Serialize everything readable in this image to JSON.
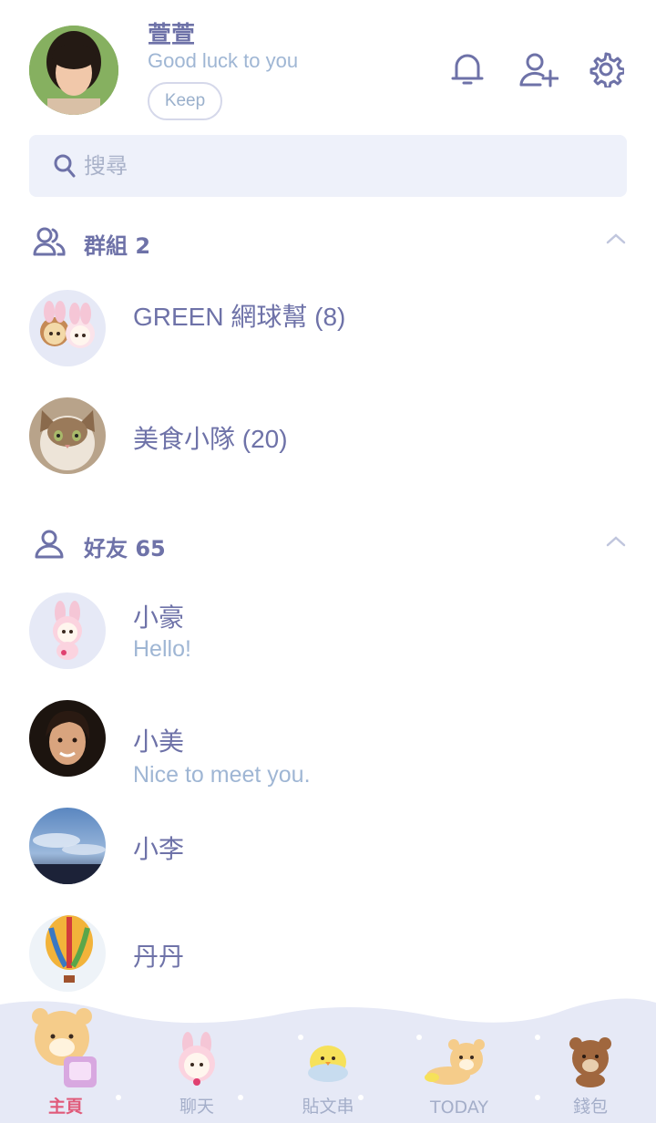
{
  "profile": {
    "name": "萱萱",
    "status": "Good luck to you",
    "keep_label": "Keep"
  },
  "header_icons": [
    "bell-icon",
    "add-friend-icon",
    "settings-gear-icon"
  ],
  "search": {
    "placeholder": "搜尋"
  },
  "groups": {
    "header": "群組 2",
    "items": [
      {
        "title": "GREEN 網球幫 (8)",
        "avatar": "rilakkuma-bunny-pair"
      },
      {
        "title": "美食小隊 (20)",
        "avatar": "cat-photo"
      }
    ]
  },
  "friends": {
    "header": "好友 65",
    "items": [
      {
        "name": "小豪",
        "message": "Hello!",
        "avatar": "korilakkuma-bunny"
      },
      {
        "name": "小美",
        "message": "Nice to meet you.",
        "avatar": "woman-photo"
      },
      {
        "name": "小李",
        "message": "",
        "avatar": "sky-photo"
      },
      {
        "name": "丹丹",
        "message": "",
        "avatar": "hot-air-balloon-photo"
      }
    ]
  },
  "nav": {
    "items": [
      {
        "label": "主頁",
        "active": true
      },
      {
        "label": "聊天",
        "active": false
      },
      {
        "label": "貼文串",
        "active": false
      },
      {
        "label": "TODAY",
        "active": false
      },
      {
        "label": "錢包",
        "active": false
      }
    ]
  },
  "colors": {
    "primary_text": "#6e72a8",
    "secondary_text": "#9fb6d4",
    "search_bg": "#eef1fa",
    "nav_bg": "#e6e9f6",
    "active_nav": "#e05a7a"
  }
}
